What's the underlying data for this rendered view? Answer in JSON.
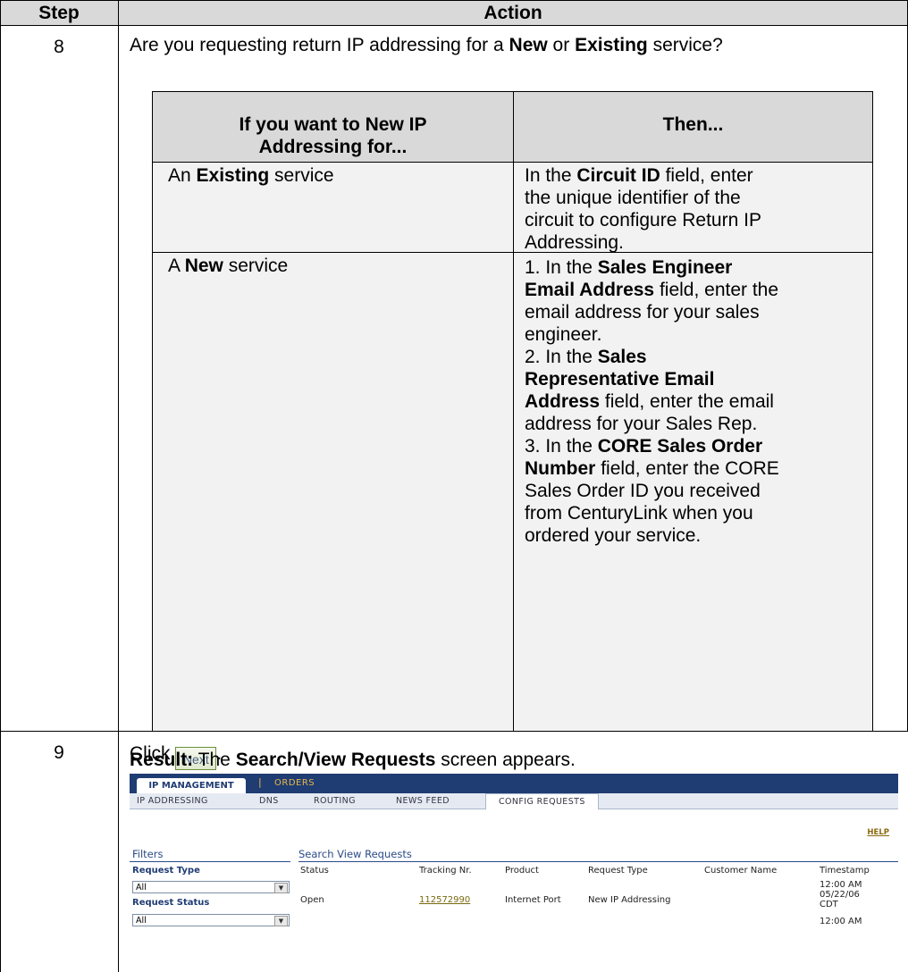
{
  "header": {
    "step": "Step",
    "action": "Action"
  },
  "step8": {
    "num": "8",
    "question": [
      "Are you requesting return IP addressing for a ",
      "New",
      " or ",
      "Existing",
      " service?"
    ],
    "inner_table": {
      "col1_header": [
        "If you want to New IP",
        "Addressing for..."
      ],
      "col2_header": "Then...",
      "row1": {
        "left": [
          "An ",
          "Existing",
          " service"
        ],
        "right": [
          "In the ",
          "Circuit ID",
          " field, enter",
          "the unique identifier of the",
          "circuit to configure Return IP",
          "Addressing."
        ]
      },
      "row2": {
        "left": [
          "A ",
          "New",
          " service"
        ],
        "right_lines": [
          "1. In the |Sales Engineer|",
          "|Email Address| field, enter the",
          "email address for your sales",
          "engineer.",
          "2. In the |Sales|",
          "|Representative Email|",
          "|Address| field, enter the email",
          "address for your Sales Rep.",
          "3. In the |CORE Sales Order|",
          "|Number| field, enter the CORE",
          "Sales Order ID you received",
          "from CenturyLink when you",
          "ordered your service."
        ]
      }
    }
  },
  "step9": {
    "num": "9",
    "click": "Click",
    "next_button": "Next",
    "period": ".",
    "result_label": "Result:",
    "result_text_1": "The ",
    "result_bold": "Search/View Requests",
    "result_text_2": "  screen appears."
  },
  "screenshot": {
    "tab_ip": "IP MANAGEMENT",
    "sep": "|",
    "tab_orders": "ORDERS",
    "subnav": [
      "IP ADDRESSING",
      "DNS",
      "ROUTING",
      "NEWS FEED",
      "CONFIG REQUESTS"
    ],
    "help": "HELP",
    "filters": "Filters",
    "request_type": "Request Type",
    "request_type_value": "All",
    "request_status": "Request Status",
    "request_status_value": "All",
    "search_title": "Search View Requests",
    "columns": [
      "Status",
      "Tracking Nr.",
      "Product",
      "Request Type",
      "Customer Name",
      "Timestamp"
    ],
    "row": {
      "status": "Open",
      "tracking": "112572990",
      "product": "Internet Port",
      "request_type": "New IP Addressing",
      "customer_name": "",
      "timestamp": [
        "12:00 AM",
        "05/22/06",
        "CDT"
      ]
    },
    "next_timestamp": "12:00 AM"
  },
  "colors": {
    "nav_bg": "#1f3c73",
    "header_fill": "#d9d9d9",
    "link": "#7a6a10"
  }
}
